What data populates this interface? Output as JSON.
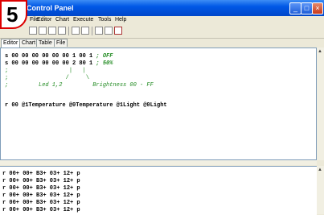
{
  "step_badge": "5",
  "window": {
    "title": "Control Panel"
  },
  "window_buttons": {
    "minimize": "_",
    "maximize": "□",
    "close": "×"
  },
  "menu": [
    "File",
    "Editor",
    "Chart",
    "Execute",
    "Tools",
    "Help"
  ],
  "tabs": [
    "Editor",
    "Chart",
    "Table",
    "File"
  ],
  "editor": {
    "lines": [
      {
        "code": "s 00 00 00 00 00 00 1 00 1",
        "comment": " ; OFF"
      },
      {
        "code": "s 00 00 00 00 00 00 2 80 1",
        "comment": " ; 50%"
      },
      {
        "code": ";                  |   |",
        "comment": ""
      },
      {
        "code": ";                 /     \\",
        "comment": ""
      },
      {
        "code": ";         Led 1,2         Brightness 00 - FF",
        "comment": ""
      },
      {
        "code": "",
        "comment": ""
      },
      {
        "code": "r 00 @1Temperature @0Temperature @1Light @0Light",
        "comment": ""
      }
    ]
  },
  "console": {
    "lines": [
      "r 00+ 00+ B3+ 03+ 12+ p",
      "r 00+ 00+ B3+ 03+ 12+ p",
      "r 00+ 00+ B3+ 03+ 12+ p",
      "r 00+ 00+ B3+ 03+ 12+ p",
      "r 00+ 00+ B3+ 03+ 12+ p",
      "r 00+ 00+ B3+ 03+ 12+ p"
    ]
  },
  "colors": {
    "titlebar": "#0058e6",
    "comment": "#228b22",
    "badge_border": "#dd0000"
  }
}
